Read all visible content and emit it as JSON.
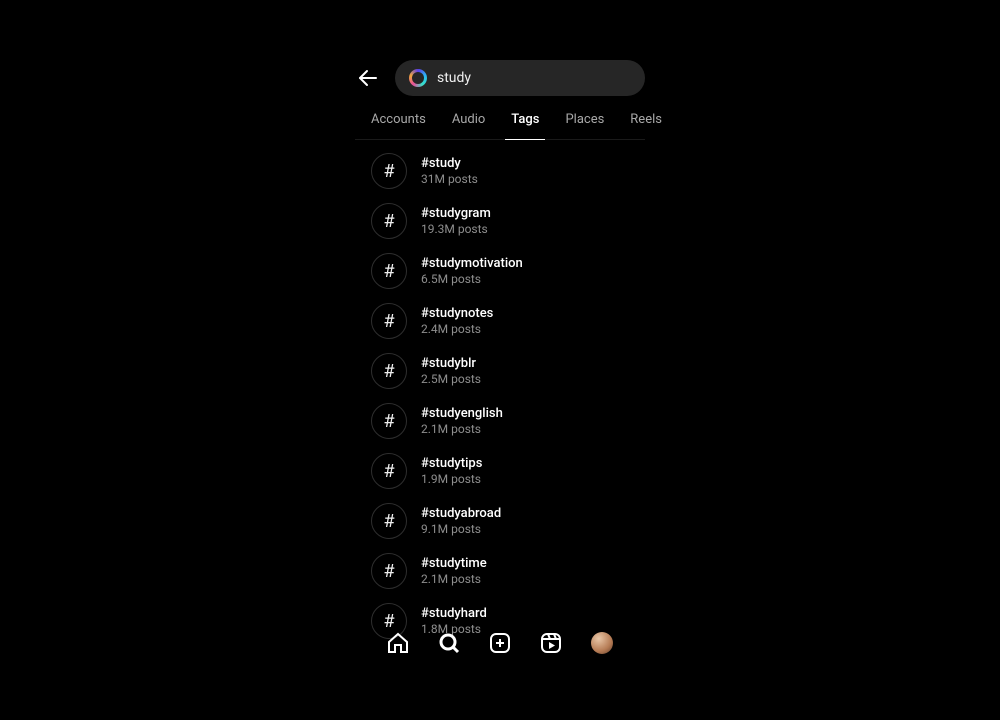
{
  "search": {
    "value": "study"
  },
  "tabs": {
    "accounts": "Accounts",
    "audio": "Audio",
    "tags": "Tags",
    "places": "Places",
    "reels": "Reels",
    "active": "tags"
  },
  "results": [
    {
      "tag": "#study",
      "posts": "31M posts"
    },
    {
      "tag": "#studygram",
      "posts": "19.3M posts"
    },
    {
      "tag": "#studymotivation",
      "posts": "6.5M posts"
    },
    {
      "tag": "#studynotes",
      "posts": "2.4M posts"
    },
    {
      "tag": "#studyblr",
      "posts": "2.5M posts"
    },
    {
      "tag": "#studyenglish",
      "posts": "2.1M posts"
    },
    {
      "tag": "#studytips",
      "posts": "1.9M posts"
    },
    {
      "tag": "#studyabroad",
      "posts": "9.1M posts"
    },
    {
      "tag": "#studytime",
      "posts": "2.1M posts"
    },
    {
      "tag": "#studyhard",
      "posts": "1.8M posts"
    }
  ],
  "hash_glyph": "#"
}
